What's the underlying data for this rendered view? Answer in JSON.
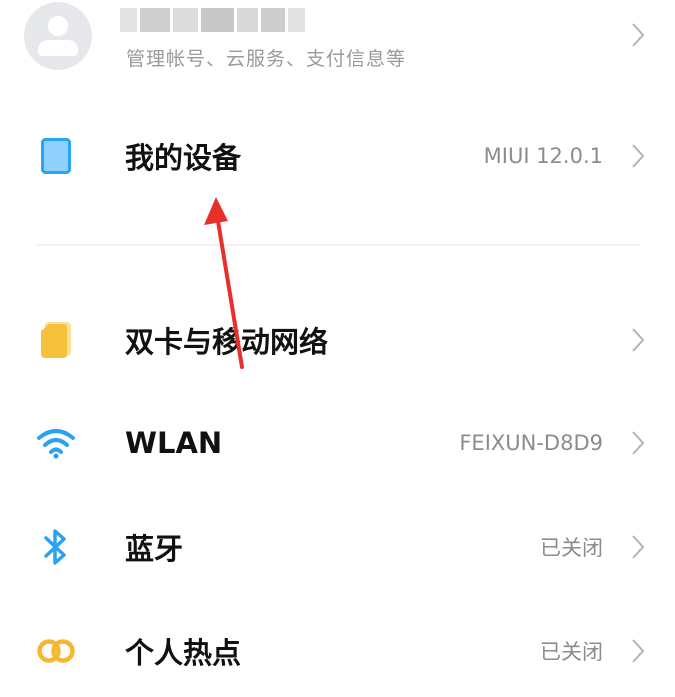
{
  "account": {
    "subtitle": "管理帐号、云服务、支付信息等",
    "icon": "avatar-icon"
  },
  "rows": [
    {
      "label": "我的设备",
      "value": "MIUI 12.0.1",
      "icon": "tablet-icon"
    },
    {
      "label": "双卡与移动网络",
      "value": "",
      "icon": "sim-card-icon"
    },
    {
      "label": "WLAN",
      "value": "FEIXUN-D8D9",
      "icon": "wifi-icon"
    },
    {
      "label": "蓝牙",
      "value": "已关闭",
      "icon": "bluetooth-icon"
    },
    {
      "label": "个人热点",
      "value": "已关闭",
      "icon": "hotspot-icon"
    }
  ],
  "colors": {
    "accent_blue": "#2aa3f0",
    "sim_yellow": "#f6c23c",
    "hotspot_yellow": "#f5b82e",
    "annotation_red": "#e8302b",
    "secondary_text": "#8c8c8c"
  }
}
